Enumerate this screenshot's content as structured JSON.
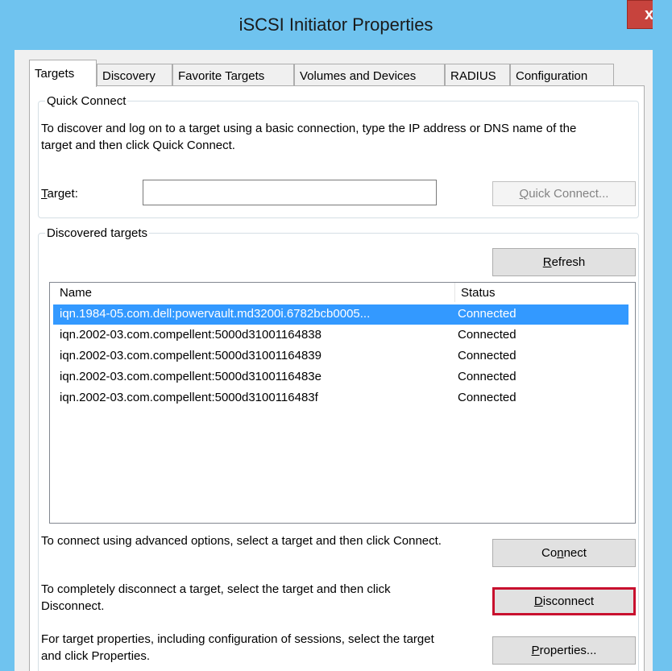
{
  "window": {
    "title": "iSCSI Initiator Properties",
    "close_glyph": "x"
  },
  "tabs": [
    {
      "label": "Targets",
      "active": true
    },
    {
      "label": "Discovery",
      "active": false
    },
    {
      "label": "Favorite Targets",
      "active": false
    },
    {
      "label": "Volumes and Devices",
      "active": false
    },
    {
      "label": "RADIUS",
      "active": false
    },
    {
      "label": "Configuration",
      "active": false
    }
  ],
  "quick_connect": {
    "legend": "Quick Connect",
    "description": "To discover and log on to a target using a basic connection, type the IP address or DNS name of the target and then click Quick Connect.",
    "target_label_accel": "T",
    "target_label_rest": "arget:",
    "target_value": "",
    "button_accel": "Q",
    "button_rest": "uick Connect..."
  },
  "discovered": {
    "legend_pre": "Discovered tar",
    "legend_accel": "g",
    "legend_post": "ets",
    "refresh_accel": "R",
    "refresh_rest": "efresh",
    "columns": {
      "name": "Name",
      "status": "Status"
    },
    "rows": [
      {
        "name": "iqn.1984-05.com.dell:powervault.md3200i.6782bcb0005...",
        "status": "Connected",
        "selected": true
      },
      {
        "name": "iqn.2002-03.com.compellent:5000d31001164838",
        "status": "Connected",
        "selected": false
      },
      {
        "name": "iqn.2002-03.com.compellent:5000d31001164839",
        "status": "Connected",
        "selected": false
      },
      {
        "name": "iqn.2002-03.com.compellent:5000d3100116483e",
        "status": "Connected",
        "selected": false
      },
      {
        "name": "iqn.2002-03.com.compellent:5000d3100116483f",
        "status": "Connected",
        "selected": false
      }
    ]
  },
  "actions": {
    "connect_desc": "To connect using advanced options, select a target and then click Connect.",
    "connect_pre": "Co",
    "connect_accel": "n",
    "connect_post": "nect",
    "disconnect_desc": "To completely disconnect a target, select the target and then click Disconnect.",
    "disconnect_accel": "D",
    "disconnect_rest": "isconnect",
    "properties_desc": "For target properties, including configuration of sessions, select the target and click Properties.",
    "properties_accel": "P",
    "properties_rest": "roperties..."
  }
}
